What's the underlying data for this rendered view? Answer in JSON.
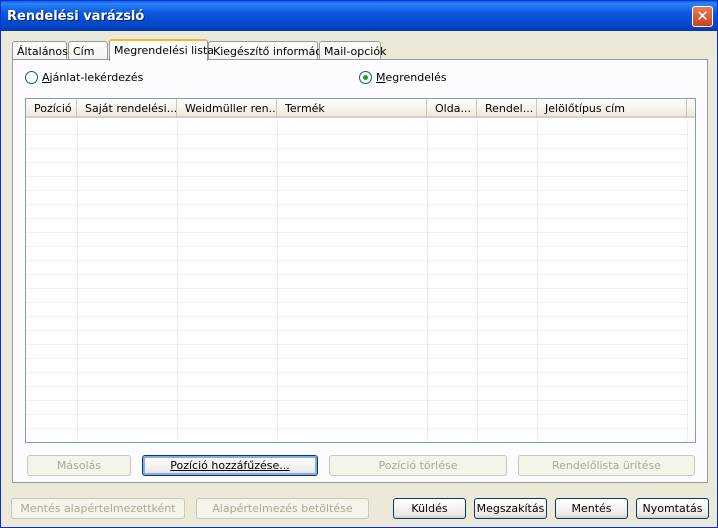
{
  "window": {
    "title": "Rendelési varázsló"
  },
  "tabs": [
    {
      "label": "Általános"
    },
    {
      "label": "Cím"
    },
    {
      "label": "Megrendelési lista"
    },
    {
      "label": "Kiegészítő információ"
    },
    {
      "label": "Mail-opciók"
    }
  ],
  "request_type": {
    "quote_label": "Ajánlat-lekérdezés",
    "order_label": "Megrendelés",
    "selected": "Megrendelés"
  },
  "list": {
    "columns": [
      {
        "label": "Pozíció"
      },
      {
        "label": "Saját rendelési..."
      },
      {
        "label": "Weidmüller ren..."
      },
      {
        "label": "Termék"
      },
      {
        "label": "Olda..."
      },
      {
        "label": "Rendel..."
      },
      {
        "label": "Jelölőtípus cím"
      }
    ],
    "rows": []
  },
  "list_buttons": {
    "copy": "Másolás",
    "add_position": "Pozíció hozzáfűzése...",
    "delete_position": "Pozíció törlése",
    "clear_list": "Rendelőlista ürítése"
  },
  "footer_buttons": {
    "save_default": "Mentés alapértelmezettként",
    "load_default": "Alapértelmezés betöltése",
    "send": "Küldés",
    "cancel": "Megszakítás",
    "save": "Mentés",
    "print": "Nyomtatás"
  }
}
